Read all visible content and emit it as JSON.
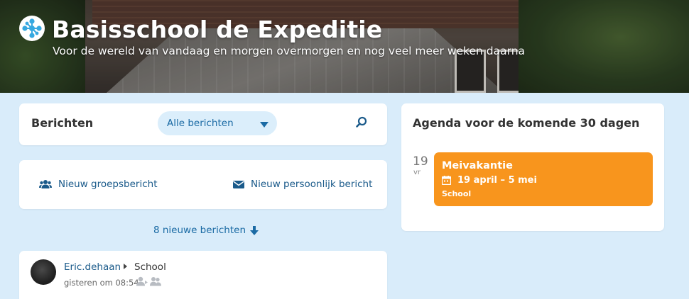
{
  "header": {
    "title": "Basisschool de Expeditie",
    "tagline": "Voor de wereld van vandaag en morgen overmorgen en nog veel meer weken daarna",
    "logo_icon": "school-logo-icon"
  },
  "berichten": {
    "title": "Berichten",
    "filter_value": "Alle berichten",
    "search_icon": "search-icon"
  },
  "new_message": {
    "group_label": "Nieuw groepsbericht",
    "personal_label": "Nieuw persoonlijk bericht",
    "group_icon": "users-icon",
    "personal_icon": "envelope-icon"
  },
  "new_posts": {
    "label": "8 nieuwe berichten",
    "icon": "arrow-down-icon"
  },
  "posts": [
    {
      "author": "Eric.dehaan",
      "group": "School",
      "time": "gisteren om 08:54"
    }
  ],
  "agenda": {
    "title": "Agenda voor de komende 30 dagen",
    "events": [
      {
        "day": "19",
        "weekday": "vr",
        "title": "Meivakantie",
        "dates": "19 april – 5 mei",
        "category": "School",
        "color": "#f8951d"
      }
    ]
  },
  "colors": {
    "background": "#d9ecfa",
    "accent": "#1a6aa4",
    "event": "#f8951d"
  }
}
